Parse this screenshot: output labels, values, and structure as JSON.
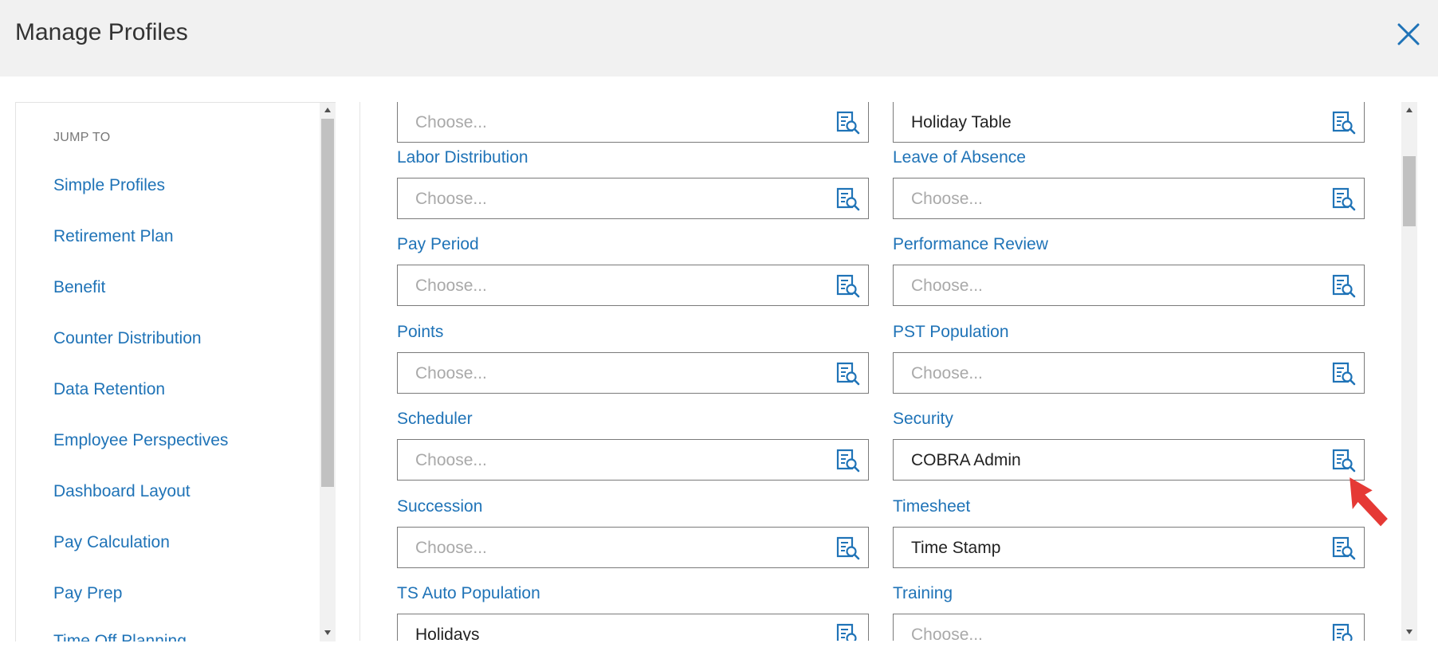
{
  "window": {
    "title": "Manage Profiles"
  },
  "sidebar": {
    "heading": "JUMP TO",
    "items": [
      {
        "label": "Simple Profiles"
      },
      {
        "label": "Retirement Plan"
      },
      {
        "label": "Benefit"
      },
      {
        "label": "Counter Distribution"
      },
      {
        "label": "Data Retention"
      },
      {
        "label": "Employee Perspectives"
      },
      {
        "label": "Dashboard Layout"
      },
      {
        "label": "Pay Calculation"
      },
      {
        "label": "Pay Prep"
      },
      {
        "label": "Time Off Planning"
      }
    ]
  },
  "fields": {
    "top_left": {
      "value": "",
      "placeholder": "Choose..."
    },
    "top_right": {
      "value": "Holiday Table",
      "placeholder": "Choose..."
    },
    "labor_distribution": {
      "label": "Labor Distribution",
      "value": "",
      "placeholder": "Choose..."
    },
    "leave_of_absence": {
      "label": "Leave of Absence",
      "value": "",
      "placeholder": "Choose..."
    },
    "pay_period": {
      "label": "Pay Period",
      "value": "",
      "placeholder": "Choose..."
    },
    "performance_review": {
      "label": "Performance Review",
      "value": "",
      "placeholder": "Choose..."
    },
    "points": {
      "label": "Points",
      "value": "",
      "placeholder": "Choose..."
    },
    "pst_population": {
      "label": "PST Population",
      "value": "",
      "placeholder": "Choose..."
    },
    "scheduler": {
      "label": "Scheduler",
      "value": "",
      "placeholder": "Choose..."
    },
    "security": {
      "label": "Security",
      "value": "COBRA Admin",
      "placeholder": "Choose..."
    },
    "succession": {
      "label": "Succession",
      "value": "",
      "placeholder": "Choose..."
    },
    "timesheet": {
      "label": "Timesheet",
      "value": "Time Stamp",
      "placeholder": "Choose..."
    },
    "ts_auto_population": {
      "label": "TS Auto Population",
      "value": "Holidays",
      "placeholder": "Choose..."
    },
    "training": {
      "label": "Training",
      "value": "",
      "placeholder": "Choose..."
    }
  },
  "colors": {
    "accent": "#1f73b7",
    "header_bg": "#f1f1f1",
    "placeholder": "#a9a9a9",
    "pointer": "#e53935"
  },
  "icons": {
    "close": "close-icon",
    "lookup": "search-list-icon",
    "pointer": "red-arrow-pointer"
  }
}
